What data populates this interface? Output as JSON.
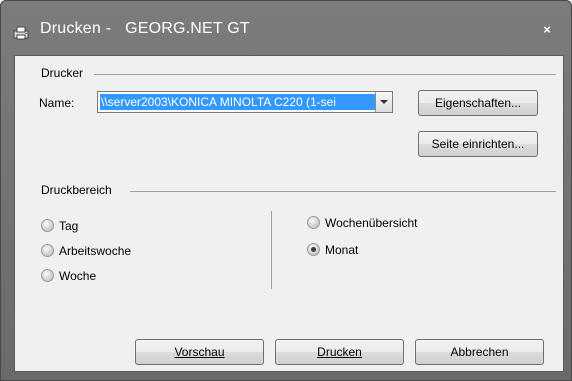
{
  "window": {
    "title": "Drucken -   GEORG.NET GT",
    "close_label": "×"
  },
  "printer_group": {
    "title": "Drucker",
    "name_label": "Name:",
    "printer_value": "\\\\server2003\\KONICA MINOLTA C220 (1-sei",
    "properties_button": "Eigenschaften...",
    "page_setup_button": "Seite einrichten..."
  },
  "range_group": {
    "title": "Druckbereich",
    "options_left": [
      {
        "label": "Tag",
        "checked": false
      },
      {
        "label": "Arbeitswoche",
        "checked": false
      },
      {
        "label": "Woche",
        "checked": false
      }
    ],
    "options_right": [
      {
        "label": "Wochenübersicht",
        "checked": false
      },
      {
        "label": "Monat",
        "checked": true
      }
    ]
  },
  "footer": {
    "preview_button": "Vorschau",
    "print_button": "Drucken",
    "cancel_button": "Abbrechen"
  },
  "colors": {
    "titlebar": "#727272",
    "selection": "#3399ff",
    "dialog_bg": "#f0f0f0"
  }
}
